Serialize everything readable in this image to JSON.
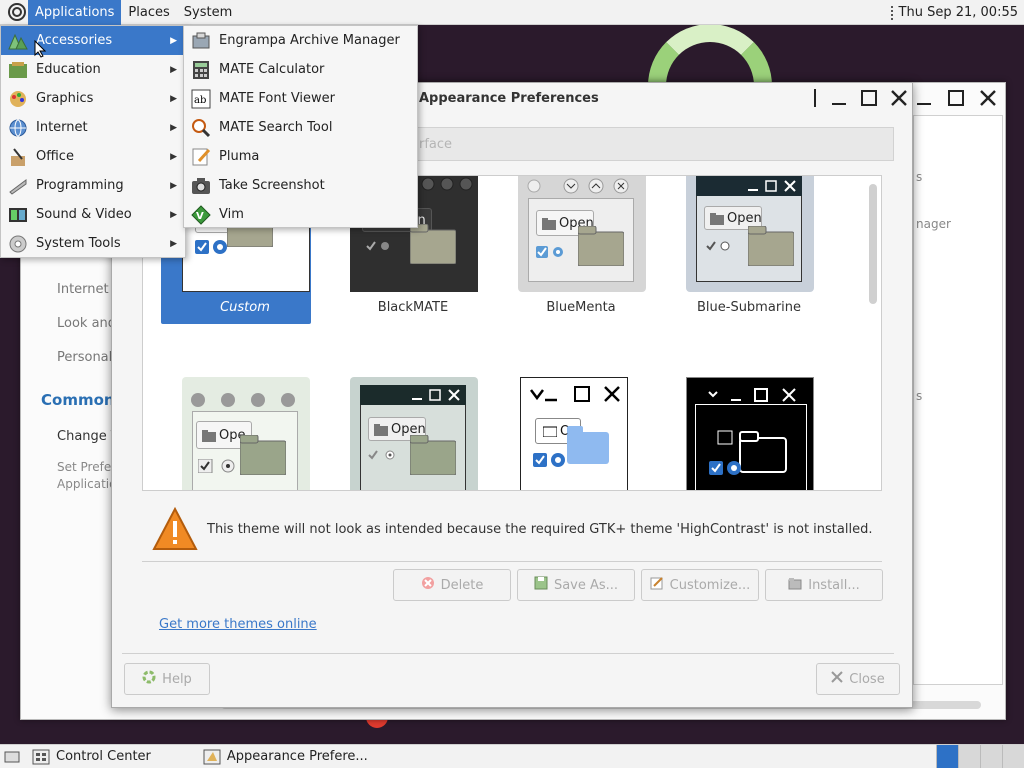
{
  "top_panel": {
    "menus": [
      "Applications",
      "Places",
      "System"
    ],
    "clock": "Thu Sep 21, 00:55"
  },
  "app_menu": {
    "items": [
      {
        "label": "Accessories",
        "icon": "accessories-icon"
      },
      {
        "label": "Education",
        "icon": "education-icon"
      },
      {
        "label": "Graphics",
        "icon": "graphics-icon"
      },
      {
        "label": "Internet",
        "icon": "internet-icon"
      },
      {
        "label": "Office",
        "icon": "office-icon"
      },
      {
        "label": "Programming",
        "icon": "programming-icon"
      },
      {
        "label": "Sound & Video",
        "icon": "sound-video-icon"
      },
      {
        "label": "System Tools",
        "icon": "system-tools-icon"
      }
    ],
    "active_index": 0
  },
  "sub_menu": {
    "items": [
      {
        "label": "Engrampa Archive Manager",
        "icon": "archive-icon"
      },
      {
        "label": "MATE Calculator",
        "icon": "calculator-icon"
      },
      {
        "label": "MATE Font Viewer",
        "icon": "font-viewer-icon"
      },
      {
        "label": "MATE Search Tool",
        "icon": "search-icon"
      },
      {
        "label": "Pluma",
        "icon": "text-editor-icon"
      },
      {
        "label": "Take Screenshot",
        "icon": "camera-icon"
      },
      {
        "label": "Vim",
        "icon": "vim-icon"
      }
    ]
  },
  "control_center": {
    "sidebar_texts": [
      "Internet a",
      "Look and",
      "Personal"
    ],
    "common_heading": "Common T",
    "change_item": "Change T",
    "set_line1": "Set Prefe",
    "set_line2": "Applicatio",
    "right_texts": [
      "s",
      "nager",
      "s"
    ]
  },
  "appearance": {
    "title": "Appearance Preferences",
    "tab_label": "rface",
    "themes": [
      {
        "name": "Custom",
        "selected": true
      },
      {
        "name": "BlackMATE"
      },
      {
        "name": "BlueMenta"
      },
      {
        "name": "Blue-Submarine"
      },
      {
        "name": ""
      },
      {
        "name": ""
      },
      {
        "name": ""
      },
      {
        "name": ""
      }
    ],
    "thumb_text": {
      "open": "Open",
      "open_partial": "O",
      "open_clipped": "Ope"
    },
    "warning": "This theme will not look as intended because the required GTK+ theme 'HighContrast' is not installed.",
    "buttons": {
      "delete": "Delete",
      "save_as": "Save As...",
      "customize": "Customize...",
      "install": "Install..."
    },
    "more_link": "Get more themes online",
    "help": "Help",
    "close": "Close"
  },
  "bottom_panel": {
    "tasks": [
      "Control Center",
      "Appearance Prefere..."
    ]
  },
  "colors": {
    "selection": "#3a78c9",
    "link": "#3a78c9",
    "warning": "#f08a24"
  }
}
